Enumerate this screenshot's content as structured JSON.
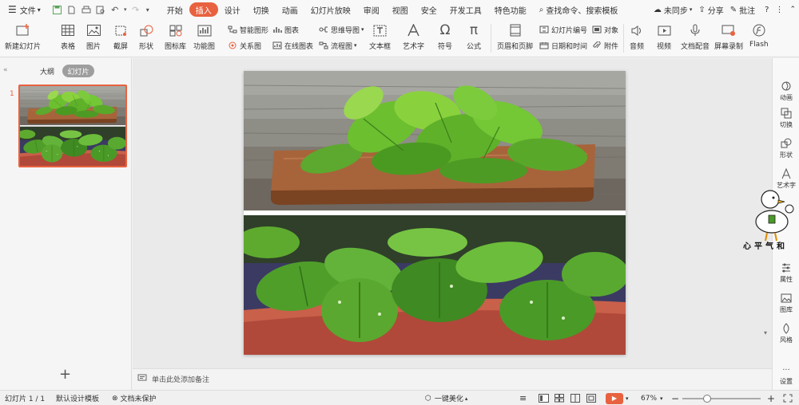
{
  "menubar": {
    "file_label": "文件",
    "tabs": [
      "开始",
      "插入",
      "设计",
      "切换",
      "动画",
      "幻灯片放映",
      "审阅",
      "视图",
      "安全",
      "开发工具",
      "特色功能"
    ],
    "active_tab": "插入",
    "search_label": "查找命令、搜索模板",
    "sync_label": "未同步",
    "share_label": "分享",
    "comment_label": "批注",
    "help_label": "?"
  },
  "ribbon": {
    "new_slide": "新建幻灯片",
    "table": "表格",
    "picture": "图片",
    "screenshot": "截屏",
    "shape": "形状",
    "icon_lib": "图标库",
    "function_chart": "功能图",
    "smart_art": "智能图形",
    "chart": "图表",
    "relation": "关系图",
    "online_chart": "在线图表",
    "mind_map": "思维导图",
    "flowchart": "流程图",
    "textbox": "文本框",
    "wordart": "艺术字",
    "symbol": "符号",
    "formula": "公式",
    "header_footer": "页眉和页脚",
    "slide_number": "幻灯片编号",
    "object": "对象",
    "datetime": "日期和时间",
    "attachment": "附件",
    "audio": "音频",
    "video": "视频",
    "dub": "文档配音",
    "screen_record": "屏幕录制",
    "flash": "Flash"
  },
  "leftpanel": {
    "tab_outline": "大纲",
    "tab_slides": "幻灯片",
    "slide_number": "1",
    "add_icon_label": "+"
  },
  "notes": {
    "placeholder": "单击此处添加备注"
  },
  "rightbar": {
    "items": [
      "动画",
      "切换",
      "形状",
      "艺术字",
      "属性",
      "图库",
      "风格",
      "设置"
    ]
  },
  "statusbar": {
    "slide_count": "幻灯片 1 / 1",
    "template": "默认设计模板",
    "protect": "文档未保护",
    "beautify": "一键美化",
    "zoom": "67%"
  },
  "mascot": {
    "text": "心平气和"
  },
  "colors": {
    "accent": "#e8623f",
    "ribbon_bg": "#f8f8f8"
  }
}
